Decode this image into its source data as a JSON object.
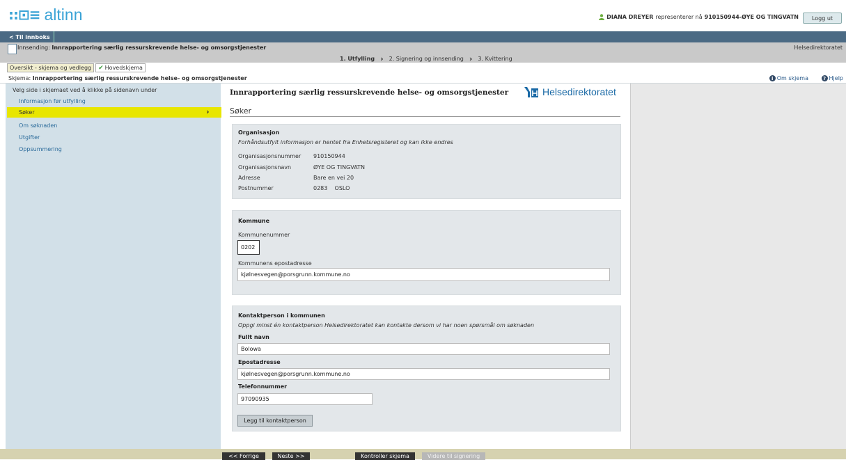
{
  "brand": {
    "logo_mark": "::⊡≡",
    "logo_text": "altinn"
  },
  "user": {
    "name": "DIANA DREYER",
    "represents_text": "representerer nå",
    "org": "910150944-ØYE OG TINGVATN",
    "logout": "Logg ut"
  },
  "nav": {
    "back_inbox": "< Til innboks"
  },
  "sending": {
    "prefix": "Innsending:",
    "title": "Innrapportering særlig ressurskrevende helse- og omsorgstjenester",
    "agency": "Helsedirektoratet",
    "steps": [
      "1. Utfylling",
      "2. Signering og innsending",
      "3. Kvittering"
    ]
  },
  "tabs": {
    "overview": "Oversikt - skjema og vedlegg",
    "main": "Hovedskjema"
  },
  "skjema": {
    "prefix": "Skjema:",
    "title": "Innrapportering særlig ressurskrevende helse- og omsorgstjenester",
    "about": "Om skjema",
    "help": "Hjelp"
  },
  "sidebar": {
    "instruction": "Velg side i skjemaet ved å klikke på sidenavn under",
    "items": [
      "Informasjon før utfylling",
      "Søker",
      "Om søknaden",
      "Utgifter",
      "Oppsummering"
    ],
    "active_index": 1
  },
  "main": {
    "title": "Innrapportering særlig ressurskrevende helse- og omsorgstjenester",
    "agency_logo_text": "Helsedirektoratet",
    "section": "Søker",
    "org_panel": {
      "heading": "Organisasjon",
      "info": "Forhåndsutfylt informasjon er hentet fra Enhetsregisteret og kan ikke endres",
      "rows": [
        {
          "k": "Organisasjonsnummer",
          "v": "910150944"
        },
        {
          "k": "Organisasjonsnavn",
          "v": "ØYE OG TINGVATN"
        },
        {
          "k": "Adresse",
          "v": "Bare en vei 20"
        },
        {
          "k": "Postnummer",
          "v": "0283    OSLO"
        }
      ]
    },
    "kommune_panel": {
      "heading": "Kommune",
      "number_label": "Kommunenummer",
      "number_value": "0202",
      "email_label": "Kommunens epostadresse",
      "email_value": "kjølnesvegen@porsgrunn.kommune.no"
    },
    "contact_panel": {
      "heading": "Kontaktperson i kommunen",
      "info": "Oppgi minst én kontaktperson Helsedirektoratet kan kontakte dersom vi har noen spørsmål om søknaden",
      "name_label": "Fullt navn",
      "name_value": "Bolowa",
      "email_label": "Epostadresse",
      "email_value": "kjølnesvegen@porsgrunn.kommune.no",
      "phone_label": "Telefonnummer",
      "phone_value": "97090935",
      "add_button": "Legg til kontaktperson"
    }
  },
  "footer": {
    "prev": "<< Forrige",
    "next": "Neste >>",
    "check": "Kontroller skjema",
    "sign": "Videre til signering"
  }
}
